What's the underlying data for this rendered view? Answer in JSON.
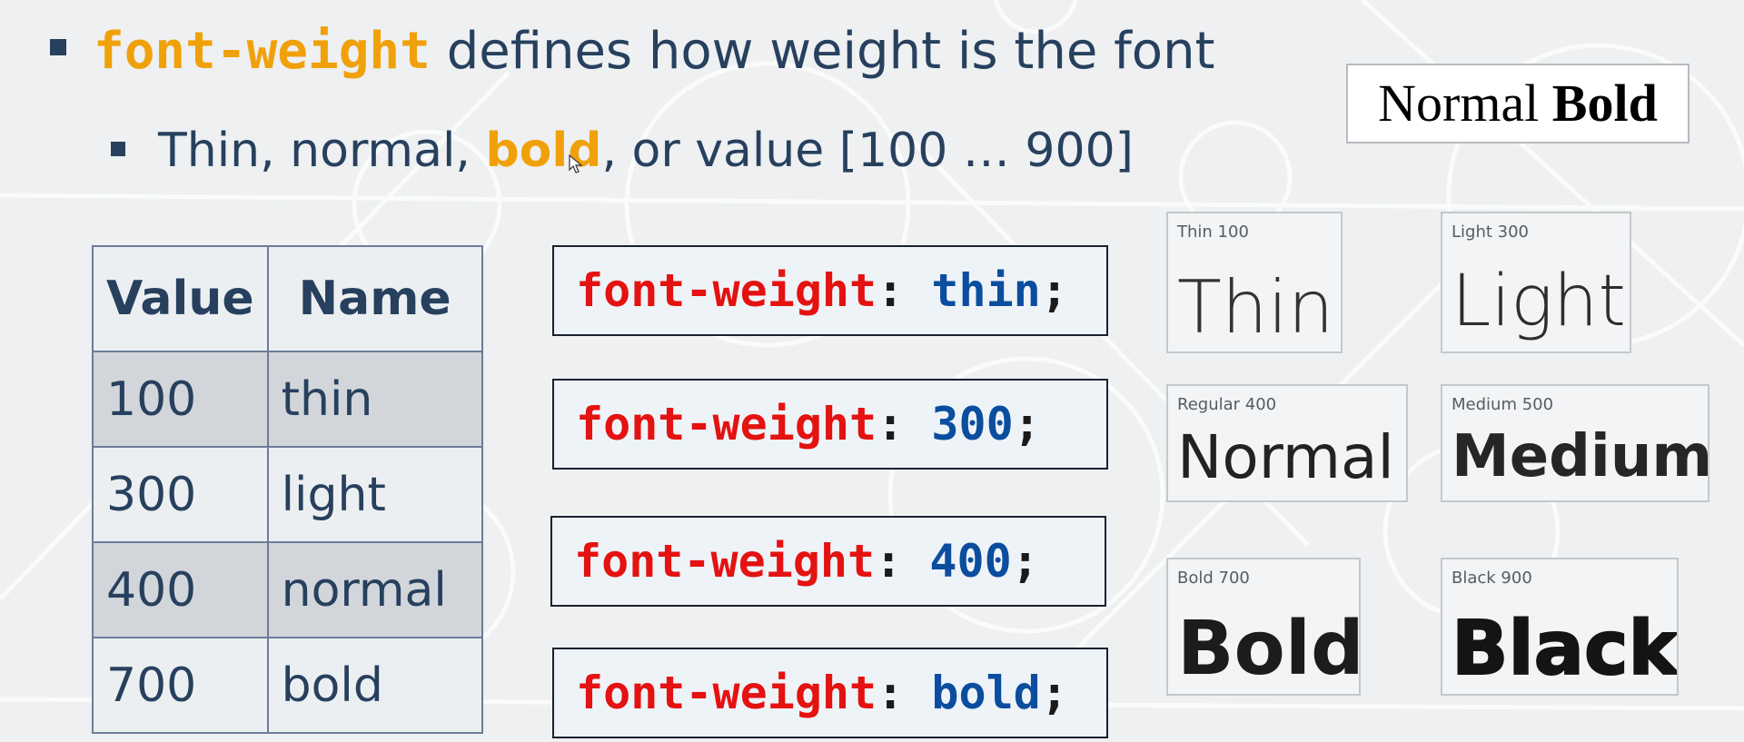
{
  "heading": {
    "keyword": "font-weight",
    "text": "defines how weight is the font"
  },
  "subheading": {
    "before": "Thin, normal, ",
    "highlight": "bold",
    "after": ", or value [100 … 900]"
  },
  "table": {
    "headers": [
      "Value",
      "Name"
    ],
    "rows": [
      [
        "100",
        "thin"
      ],
      [
        "300",
        "light"
      ],
      [
        "400",
        "normal"
      ],
      [
        "700",
        "bold"
      ]
    ]
  },
  "code_blocks": [
    {
      "property": "font-weight",
      "colon": ":",
      "value": "thin",
      "semi": ";"
    },
    {
      "property": "font-weight",
      "colon": ":",
      "value": "300",
      "semi": ";"
    },
    {
      "property": "font-weight",
      "colon": ":",
      "value": "400",
      "semi": ";"
    },
    {
      "property": "font-weight",
      "colon": ":",
      "value": "bold",
      "semi": ";"
    }
  ],
  "normal_bold": {
    "normal": "Normal",
    "bold": "Bold"
  },
  "weight_samples": [
    {
      "caption": "Thin 100",
      "sample": "Thin"
    },
    {
      "caption": "Light 300",
      "sample": "Light"
    },
    {
      "caption": "Regular 400",
      "sample": "Normal"
    },
    {
      "caption": "Medium 500",
      "sample": "Medium"
    },
    {
      "caption": "Bold 700",
      "sample": "Bold"
    },
    {
      "caption": "Black 900",
      "sample": "Black"
    }
  ],
  "colors": {
    "text": "#27405e",
    "keyword": "#f0a10a",
    "css_property": "#e41210",
    "css_value": "#0b4d9e"
  }
}
